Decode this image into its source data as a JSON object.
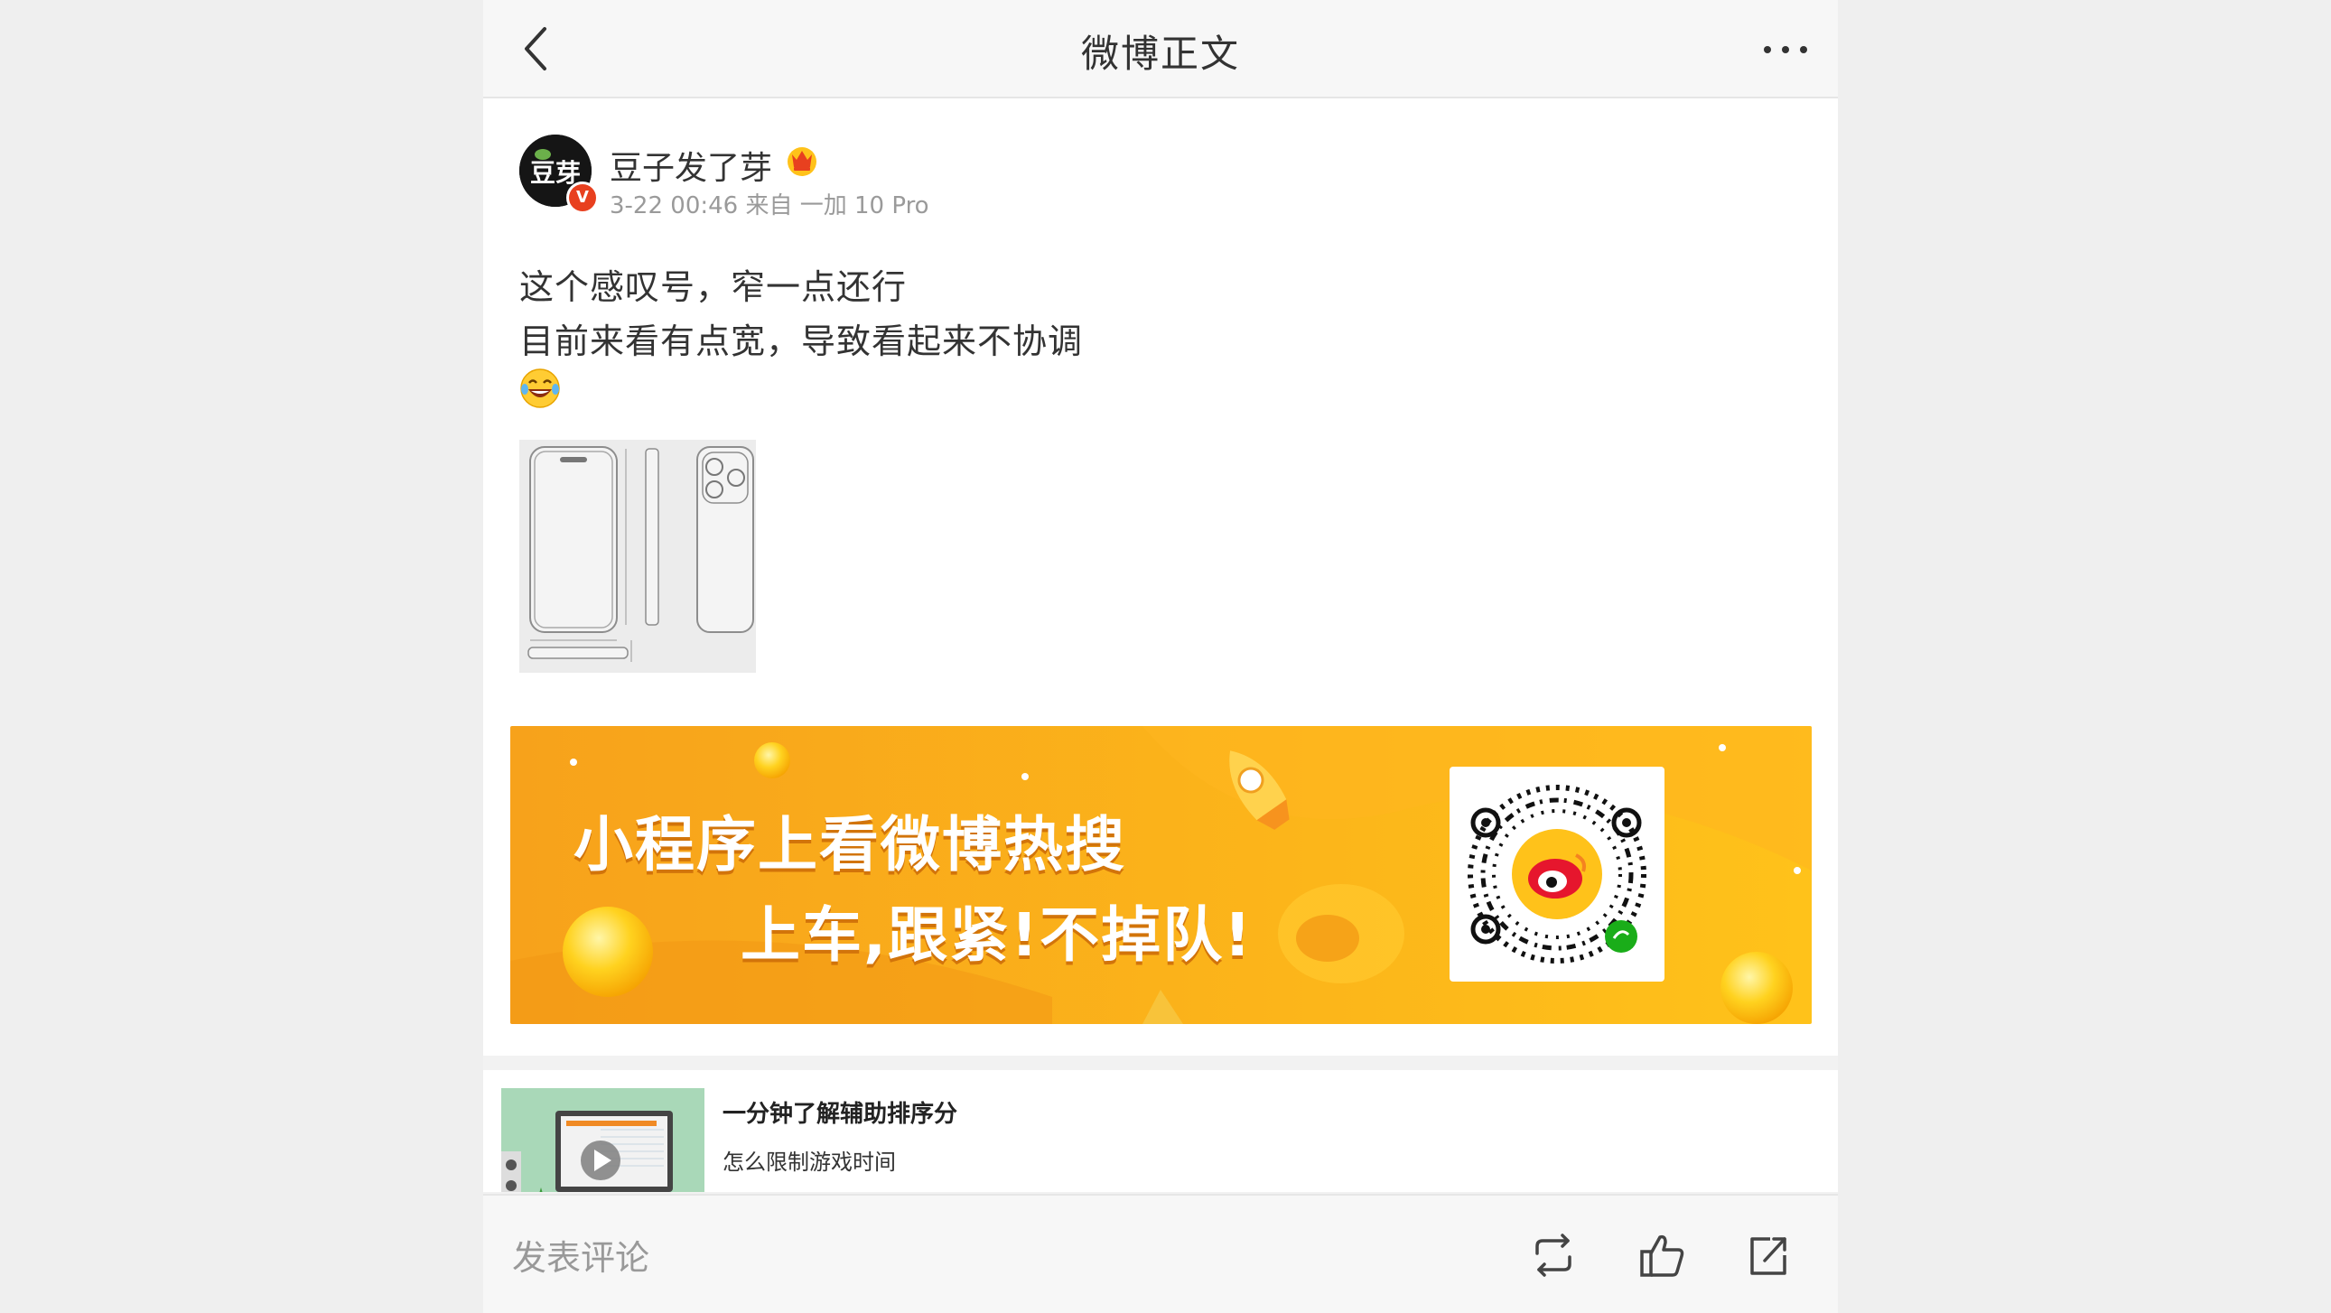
{
  "header": {
    "title": "微博正文"
  },
  "post": {
    "author": "豆子发了芽",
    "verified_label": "V",
    "avatar_text": "豆芽",
    "meta": "3-22 00:46 来自 一加 10 Pro",
    "lines": [
      "这个感叹号，窄一点还行",
      "目前来看有点宽，导致看起来不协调"
    ],
    "emoji": "laughing-tears"
  },
  "banner": {
    "line1": "小程序上看微博热搜",
    "line2": "上车,跟紧!不掉队!",
    "colors": {
      "start": "#f7a21b",
      "end": "#ffc21a"
    }
  },
  "recommendation": {
    "title": "一分钟了解辅助排序分",
    "subtitle": "怎么限制游戏时间"
  },
  "toolbar": {
    "comment_placeholder": "发表评论",
    "icons": [
      "repost-icon",
      "like-icon",
      "share-icon"
    ]
  }
}
